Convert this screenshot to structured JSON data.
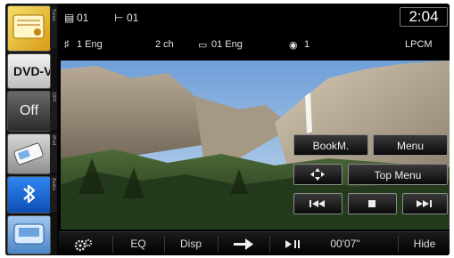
{
  "sources": {
    "dvd_label": "DVD-V",
    "off_label": "Off"
  },
  "side_tabs": [
    "Tuner",
    "OFF",
    "iPod",
    "Audio"
  ],
  "status": {
    "title_no": "01",
    "chapter_no": "01",
    "audio_track": "1 Eng",
    "channels": "2 ch",
    "subtitle": "01 Eng",
    "angle": "1",
    "audio_format": "LPCM",
    "clock": "2:04"
  },
  "overlay": {
    "bookmark_label": "BookM.",
    "menu_label": "Menu",
    "top_menu_label": "Top Menu"
  },
  "bottom_bar": {
    "eq_label": "EQ",
    "disp_label": "Disp",
    "time": "00'07\"",
    "hide_label": "Hide"
  },
  "icons": [
    "gears-icon",
    "arrow-right-icon",
    "play-pause-icon",
    "cursor-arrows-icon",
    "skip-back-icon",
    "stop-icon",
    "skip-forward-icon",
    "bluetooth-icon"
  ],
  "colors": {
    "bluetooth": "#1e6fd8",
    "button_border": "#8a8a8a",
    "sky": "#8fb2dc"
  }
}
